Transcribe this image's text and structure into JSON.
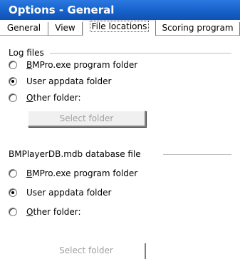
{
  "window": {
    "title": "Options - General"
  },
  "tabs": [
    {
      "label": "General"
    },
    {
      "label": "View"
    },
    {
      "label": "File locations"
    },
    {
      "label": "Scoring program"
    }
  ],
  "log_files": {
    "title": "Log files",
    "options": [
      {
        "label_prefix": "",
        "label_underlined": "B",
        "label_rest": "MPro.exe program folder",
        "selected": false
      },
      {
        "label_prefix": "User appdata folder",
        "label_underlined": "",
        "label_rest": "",
        "selected": true
      },
      {
        "label_prefix": "",
        "label_underlined": "O",
        "label_rest": "ther folder:",
        "selected": false
      }
    ],
    "select_button": "Select folder"
  },
  "database_file": {
    "title": "BMPlayerDB.mdb database file",
    "options": [
      {
        "label_prefix": "",
        "label_underlined": "B",
        "label_rest": "MPro.exe program folder",
        "selected": false
      },
      {
        "label_prefix": "User appdata folder",
        "label_underlined": "",
        "label_rest": "",
        "selected": true
      },
      {
        "label_prefix": "",
        "label_underlined": "O",
        "label_rest": "ther folder:",
        "selected": false
      }
    ],
    "select_button": "Select folder"
  }
}
